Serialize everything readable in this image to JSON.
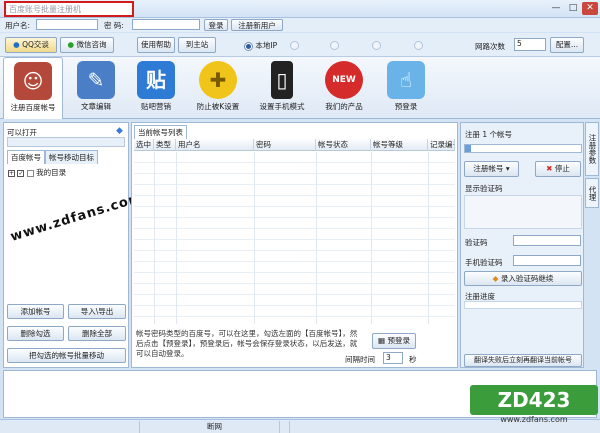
{
  "window": {
    "title": "百度账号批量注册机",
    "min": "—",
    "max": "□",
    "close": "✕"
  },
  "login": {
    "user_label": "用户名:",
    "pass_label": "密  码:",
    "login_btn": "登录",
    "register_btn": "注册新用户"
  },
  "row2": {
    "qq_btn": "QQ交谈",
    "weixin_btn": "微信咨询",
    "help_btn": "使用帮助",
    "home_btn": "到主站",
    "radio_local": "本地IP",
    "retry_label": "网路次数",
    "retry_value": "5",
    "config_btn": "配置..."
  },
  "toolbar": [
    {
      "label": "注册百度帐号",
      "icon": "user-add-icon"
    },
    {
      "label": "文章编辑",
      "icon": "edit-icon"
    },
    {
      "label": "贴吧营销",
      "icon": "tieba-icon",
      "glyph": "贴"
    },
    {
      "label": "防止被K设置",
      "icon": "wrench-icon"
    },
    {
      "label": "设置手机模式",
      "icon": "phone-icon"
    },
    {
      "label": "我们的产品",
      "icon": "new-icon",
      "glyph": "NEW"
    },
    {
      "label": "预登录",
      "icon": "pointer-icon"
    }
  ],
  "left": {
    "title": "可以打开",
    "tabs": [
      "百度帐号",
      "帐号移动目标"
    ],
    "tree_root": "我的目录",
    "btn_add": "添加帐号",
    "btn_import": "导入\\导出",
    "btn_del_checked": "删除勾选",
    "btn_del_all": "删除全部",
    "btn_move": "把勾选的帐号批量移动"
  },
  "center": {
    "tab": "当前帐号列表",
    "columns": [
      "选中",
      "类型",
      "用户名",
      "密码",
      "帐号状态",
      "帐号等级",
      "记录编号"
    ],
    "hint": "帐号密码类型的百度号，可以在这里，勾选左面的【百度帐号】，然后点击【预登录】，预登录后，帐号会保存登录状态，以后发送，就可以自动登录。",
    "prelogin_btn": "预登录",
    "interval_label": "间隔时间",
    "interval_value": "3",
    "interval_unit": "秒"
  },
  "right": {
    "title": "注册 1 个帐号",
    "register_btn": "注册帐号",
    "stop_btn": "停止",
    "captcha_title": "显示验证码",
    "captcha_label": "验证码",
    "phone_label": "手机验证码",
    "continue_btn": "录入验证码继续",
    "progress_label": "注册进度",
    "bottom_btn": "翻译失败后立刻再翻译当前帐号",
    "progress_value": 0.05
  },
  "sidetabs": [
    "注册参数",
    "代理"
  ],
  "status": {
    "network": "断网"
  },
  "watermark": "www.zdfans.com",
  "logo": {
    "text": "ZD423",
    "sub": "www.zdfans.com"
  },
  "colors": {
    "accent": "#2a5aa0",
    "title_border": "#d21a1a",
    "panel_bg": "#d4e3f4"
  }
}
